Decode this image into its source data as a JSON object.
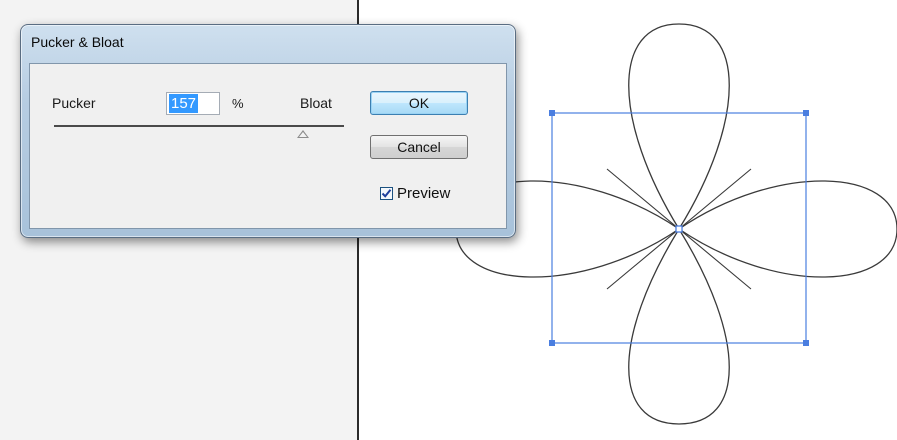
{
  "dialog": {
    "title": "Pucker & Bloat",
    "pucker_label": "Pucker",
    "bloat_label": "Bloat",
    "value": "157",
    "unit": "%",
    "slider_level": 0.86,
    "ok_label": "OK",
    "cancel_label": "Cancel",
    "preview_label": "Preview",
    "preview_checked": true
  },
  "colors": {
    "selection_blue": "#4a7ee0",
    "path_stroke": "#3a3a3a",
    "input_highlight": "#3399ff"
  },
  "icons": {
    "checkbox": "checkmark-icon",
    "slider": "triangle-thumb-icon"
  }
}
